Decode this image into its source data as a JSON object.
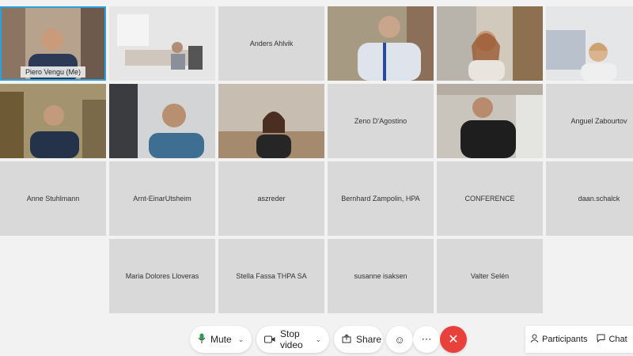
{
  "participants": [
    {
      "name": "Piero Vengu (Me)",
      "video": true,
      "active": true
    },
    {
      "name": "",
      "video": true
    },
    {
      "name": "Anders Ahlvik",
      "video": false
    },
    {
      "name": "",
      "video": true
    },
    {
      "name": "",
      "video": true
    },
    {
      "name": "",
      "video": true
    },
    {
      "name": "",
      "video": true
    },
    {
      "name": "",
      "video": true
    },
    {
      "name": "",
      "video": true
    },
    {
      "name": "Zeno D'Agostino",
      "video": false
    },
    {
      "name": "",
      "video": true
    },
    {
      "name": "Anguel Zabourtov",
      "video": false
    },
    {
      "name": "Anne Stuhlmann",
      "video": false
    },
    {
      "name": "Arnt-EinarUtsheim",
      "video": false
    },
    {
      "name": "aszreder",
      "video": false
    },
    {
      "name": "Bernhard Zampolin, HPA",
      "video": false
    },
    {
      "name": "CONFERENCE",
      "video": false
    },
    {
      "name": "daan.schalck",
      "video": false
    },
    {
      "name": "Maria Dolores Lloveras",
      "video": false
    },
    {
      "name": "Stella Fassa THPA SA",
      "video": false
    },
    {
      "name": "susanne isaksen",
      "video": false
    },
    {
      "name": "Valter Selén",
      "video": false
    }
  ],
  "controls": {
    "mute_label": "Mute",
    "stop_video_label": "Stop video",
    "share_label": "Share",
    "participants_label": "Participants",
    "chat_label": "Chat"
  },
  "icons": {
    "mic": "mic-icon",
    "video": "video-icon",
    "share": "share-icon",
    "reactions": "reactions-icon",
    "more": "more-icon",
    "end": "end-call-icon",
    "participants": "participants-icon",
    "chat": "chat-icon"
  },
  "colors": {
    "active_border": "#2aa1dd",
    "end_button": "#e8413c",
    "tile_bg": "#d9d9d9"
  }
}
